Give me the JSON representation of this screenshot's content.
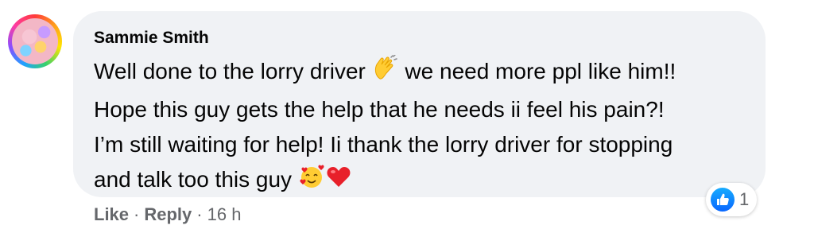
{
  "comment": {
    "author": "Sammie Smith",
    "lines": [
      {
        "before": "Well done to the lorry driver ",
        "after": " we need more ppl like him!!"
      },
      {
        "text": "Hope this guy gets the help that he needs ii feel his pain?!"
      },
      {
        "text": "I’m still waiting for help! Ii thank the lorry driver for stopping"
      },
      {
        "text": "and talk too this guy "
      }
    ],
    "emojis": {
      "clap": "clapping-hands-icon",
      "hug": "smiling-face-with-hearts-icon",
      "heart": "red-heart-icon"
    }
  },
  "reactions": {
    "type": "like-icon",
    "count": "1"
  },
  "actions": {
    "like": "Like",
    "reply": "Reply",
    "separator": "·",
    "time": "16 h"
  },
  "colors": {
    "bubble": "#f0f2f5",
    "text": "#050505",
    "meta": "#65676b",
    "like_blue": "#0866ff"
  }
}
